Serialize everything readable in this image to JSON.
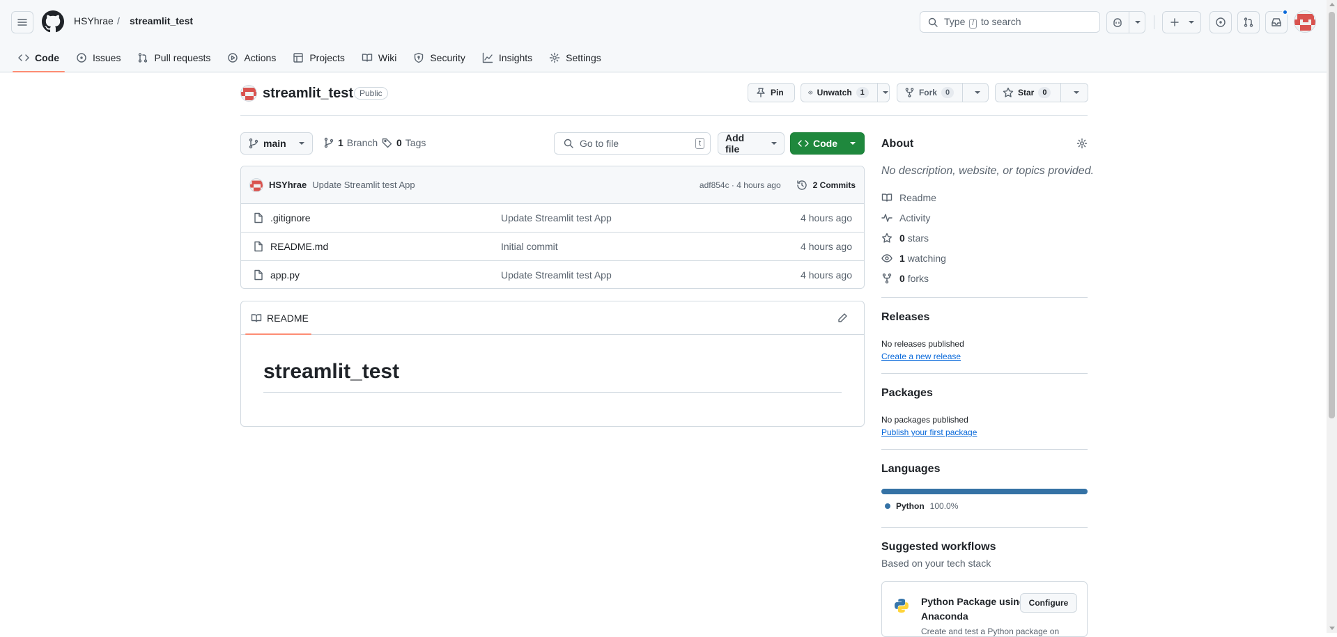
{
  "header": {
    "owner": "HSYhrae",
    "sep": "/",
    "repo": "streamlit_test",
    "search": {
      "pre": "Type",
      "key": "/",
      "post": "to search"
    }
  },
  "tabs": [
    {
      "label": "Code",
      "icon": "code-icon"
    },
    {
      "label": "Issues",
      "icon": "issue-icon"
    },
    {
      "label": "Pull requests",
      "icon": "pull-request-icon"
    },
    {
      "label": "Actions",
      "icon": "play-icon"
    },
    {
      "label": "Projects",
      "icon": "table-icon"
    },
    {
      "label": "Wiki",
      "icon": "book-icon"
    },
    {
      "label": "Security",
      "icon": "shield-icon"
    },
    {
      "label": "Insights",
      "icon": "graph-icon"
    },
    {
      "label": "Settings",
      "icon": "gear-icon"
    }
  ],
  "repo": {
    "name": "streamlit_test",
    "visibility": "Public",
    "pin": "Pin",
    "unwatch": "Unwatch",
    "watch_count": "1",
    "fork": "Fork",
    "fork_count": "0",
    "star": "Star",
    "star_count": "0"
  },
  "toolbar": {
    "branch": "main",
    "branches_count": "1",
    "branches_label": "Branch",
    "tags_count": "0",
    "tags_label": "Tags",
    "goto_placeholder": "Go to file",
    "goto_key": "t",
    "add_file": "Add file",
    "code": "Code"
  },
  "commit": {
    "author": "HSYhrae",
    "message": "Update Streamlit test App",
    "meta": "adf854c · 4 hours ago",
    "commits": "2 Commits"
  },
  "files": [
    {
      "name": ".gitignore",
      "message": "Update Streamlit test App",
      "time": "4 hours ago"
    },
    {
      "name": "README.md",
      "message": "Initial commit",
      "time": "4 hours ago"
    },
    {
      "name": "app.py",
      "message": "Update Streamlit test App",
      "time": "4 hours ago"
    }
  ],
  "readme": {
    "tab": "README",
    "heading": "streamlit_test"
  },
  "about": {
    "title": "About",
    "description": "No description, website, or topics provided.",
    "readme": "Readme",
    "activity": "Activity",
    "stars_n": "0",
    "stars": "stars",
    "watching_n": "1",
    "watching": "watching",
    "forks_n": "0",
    "forks": "forks"
  },
  "releases": {
    "title": "Releases",
    "text": "No releases published",
    "link": "Create a new release"
  },
  "packages": {
    "title": "Packages",
    "text": "No packages published",
    "link": "Publish your first package"
  },
  "languages": {
    "title": "Languages",
    "name": "Python",
    "percent": "100.0%",
    "fraction": 1.0,
    "color": "#3572A5"
  },
  "workflows": {
    "title": "Suggested workflows",
    "subtitle": "Based on your tech stack",
    "card_title": "Python Package using Anaconda",
    "card_button": "Configure",
    "card_desc": "Create and test a Python package on"
  }
}
